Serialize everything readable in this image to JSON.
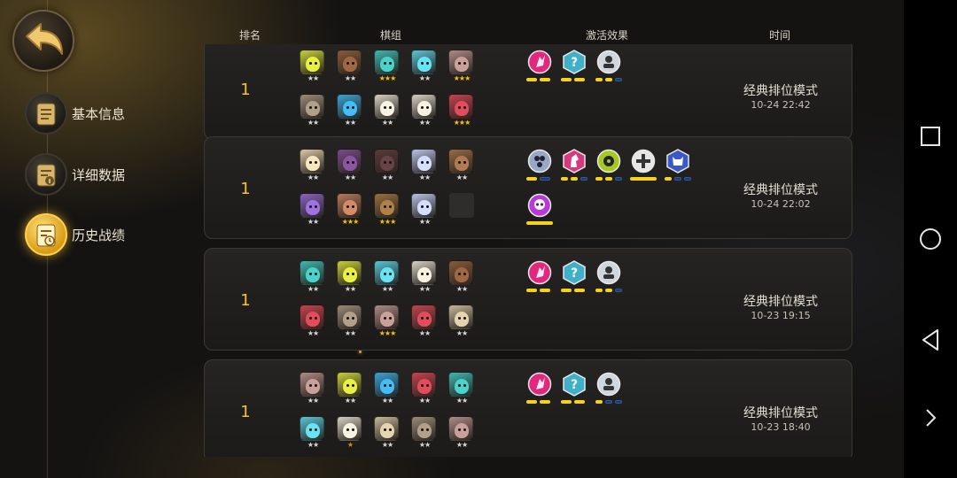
{
  "nav": {
    "items": [
      {
        "label": "基本信息",
        "icon": "document-icon",
        "active": false
      },
      {
        "label": "详细数据",
        "icon": "info-document-icon",
        "active": false
      },
      {
        "label": "历史战绩",
        "icon": "history-clock-icon",
        "active": true
      }
    ]
  },
  "table": {
    "headers": {
      "rank": "排名",
      "lineup": "棋组",
      "synergy": "激活效果",
      "time": "时间"
    },
    "rows": [
      {
        "rank": "1",
        "mode": "经典排位模式",
        "time": "10-24 22:42",
        "units": [
          {
            "name": "yellow-creature-portrait",
            "color": "#c9d13a",
            "stars": "★★",
            "star_color": "#d8d8d8"
          },
          {
            "name": "brown-warrior-portrait",
            "color": "#8a5a3a",
            "stars": "★★",
            "star_color": "#d8d8d8"
          },
          {
            "name": "teal-knight-portrait",
            "color": "#3fb8b0",
            "stars": "★★★",
            "star_color": "#f5c400"
          },
          {
            "name": "cyan-goggles-portrait",
            "color": "#59c6d6",
            "stars": "★★",
            "star_color": "#d8d8d8"
          },
          {
            "name": "pale-brute-portrait",
            "color": "#b08b86",
            "stars": "★★★",
            "star_color": "#f5c400"
          },
          {
            "name": "horned-beast-portrait",
            "color": "#9c8b78",
            "stars": "★★",
            "star_color": "#d8d8d8"
          },
          {
            "name": "blue-gem-portrait",
            "color": "#3aa4d8",
            "stars": "★★",
            "star_color": "#d8d8d8"
          },
          {
            "name": "white-sage-portrait",
            "color": "#d8d2c4",
            "stars": "★★",
            "star_color": "#d8d8d8"
          },
          {
            "name": "white-sage-portrait",
            "color": "#d8d2c4",
            "stars": "★★",
            "star_color": "#d8d8d8"
          },
          {
            "name": "red-demon-portrait",
            "color": "#c5434f",
            "stars": "★★★",
            "star_color": "#f5c400"
          }
        ],
        "synergies": [
          {
            "icon": "pink-fist-icon",
            "color": "#e0287e",
            "bars": 2,
            "filled": 2
          },
          {
            "icon": "mystery-hex-icon",
            "color": "#3fb0c8",
            "bars": 2,
            "filled": 2
          },
          {
            "icon": "robot-icon",
            "color": "#cfd6de",
            "bars": 3,
            "filled": 2
          }
        ]
      },
      {
        "rank": "1",
        "mode": "经典排位模式",
        "time": "10-24 22:02",
        "units": [
          {
            "name": "bald-monk-portrait",
            "color": "#d8c8a6",
            "stars": "★★",
            "star_color": "#d8d8d8"
          },
          {
            "name": "purple-viking-portrait",
            "color": "#7a4a8a",
            "stars": "★★",
            "star_color": "#d8d8d8"
          },
          {
            "name": "dark-elf-portrait",
            "color": "#5a3a3a",
            "stars": "★★",
            "star_color": "#d8d8d8"
          },
          {
            "name": "ghost-spirit-portrait",
            "color": "#b8c2e6",
            "stars": "★★",
            "star_color": "#d8d8d8"
          },
          {
            "name": "bearded-hero-portrait",
            "color": "#9a6a48",
            "stars": "★★",
            "star_color": "#d8d8d8"
          },
          {
            "name": "violet-bat-portrait",
            "color": "#8a62c4",
            "stars": "★★",
            "star_color": "#d8d8d8"
          },
          {
            "name": "red-captain-portrait",
            "color": "#b87a5a",
            "stars": "★★★",
            "star_color": "#f5c400"
          },
          {
            "name": "wood-tree-portrait",
            "color": "#9a7040",
            "stars": "★★★",
            "star_color": "#f5c400"
          },
          {
            "name": "ghost-spirit-portrait",
            "color": "#b8c2e6",
            "stars": "★★",
            "star_color": "#d8d8d8"
          },
          {
            "name": "empty-slot",
            "color": "",
            "stars": "",
            "star_color": ""
          }
        ],
        "synergies": [
          {
            "icon": "paw-swirl-icon",
            "color": "#9aa8c8",
            "bars": 2,
            "filled": 1
          },
          {
            "icon": "pink-knight-icon",
            "color": "#d8387e",
            "bars": 3,
            "filled": 2
          },
          {
            "icon": "green-shield-icon",
            "color": "#a8c820",
            "bars": 3,
            "filled": 2
          },
          {
            "icon": "white-cross-icon",
            "color": "#e6e6e6",
            "bars": 1,
            "filled": 1
          },
          {
            "icon": "blue-demon-icon",
            "color": "#3a58c8",
            "bars": 3,
            "filled": 1
          },
          {
            "icon": "purple-skull-icon",
            "color": "#b83ad8",
            "bars": 1,
            "filled": 1
          }
        ]
      },
      {
        "rank": "1",
        "mode": "经典排位模式",
        "time": "10-23 19:15",
        "units": [
          {
            "name": "teal-knight-portrait",
            "color": "#3fb8b0",
            "stars": "★★",
            "star_color": "#d8d8d8"
          },
          {
            "name": "yellow-creature-portrait",
            "color": "#c9d13a",
            "stars": "★★",
            "star_color": "#d8d8d8"
          },
          {
            "name": "cyan-goggles-portrait",
            "color": "#59c6d6",
            "stars": "★★",
            "star_color": "#d8d8d8"
          },
          {
            "name": "white-sage-portrait",
            "color": "#d8d2c4",
            "stars": "★★",
            "star_color": "#d8d8d8"
          },
          {
            "name": "brown-warrior-portrait",
            "color": "#8a5a3a",
            "stars": "★★",
            "star_color": "#d8d8d8"
          },
          {
            "name": "red-demon-portrait",
            "color": "#c5434f",
            "stars": "★★",
            "star_color": "#d8d8d8"
          },
          {
            "name": "horned-beast-portrait",
            "color": "#9c8b78",
            "stars": "★★",
            "star_color": "#d8d8d8"
          },
          {
            "name": "pale-brute-portrait",
            "color": "#b08b86",
            "stars": "★★★",
            "star_color": "#f5c400"
          },
          {
            "name": "red-demon-portrait",
            "color": "#c5434f",
            "stars": "★★",
            "star_color": "#d8d8d8"
          },
          {
            "name": "goggle-gnome-portrait",
            "color": "#c8b89a",
            "stars": "★★",
            "star_color": "#d8d8d8"
          }
        ],
        "synergies": [
          {
            "icon": "pink-fist-icon",
            "color": "#e0287e",
            "bars": 2,
            "filled": 2
          },
          {
            "icon": "mystery-hex-icon",
            "color": "#3fb0c8",
            "bars": 2,
            "filled": 2
          },
          {
            "icon": "robot-icon",
            "color": "#cfd6de",
            "bars": 3,
            "filled": 2
          }
        ]
      },
      {
        "rank": "1",
        "mode": "经典排位模式",
        "time": "10-23 18:40",
        "units": [
          {
            "name": "pale-brute-portrait",
            "color": "#b08b86",
            "stars": "★★",
            "star_color": "#d8d8d8"
          },
          {
            "name": "yellow-creature-portrait",
            "color": "#c9d13a",
            "stars": "★★",
            "star_color": "#d8d8d8"
          },
          {
            "name": "blue-gem-portrait",
            "color": "#3aa4d8",
            "stars": "★★",
            "star_color": "#d8d8d8"
          },
          {
            "name": "red-demon-portrait",
            "color": "#c5434f",
            "stars": "★★",
            "star_color": "#d8d8d8"
          },
          {
            "name": "teal-knight-portrait",
            "color": "#3fb8b0",
            "stars": "★★",
            "star_color": "#d8d8d8"
          },
          {
            "name": "cyan-goggles-portrait",
            "color": "#59c6d6",
            "stars": "★★",
            "star_color": "#d8d8d8"
          },
          {
            "name": "white-sage-portrait",
            "color": "#d8d2c4",
            "stars": "★",
            "star_color": "#d88a20"
          },
          {
            "name": "goggle-gnome-portrait",
            "color": "#c8b89a",
            "stars": "★★",
            "star_color": "#d8d8d8"
          },
          {
            "name": "horned-beast-portrait",
            "color": "#9c8b78",
            "stars": "★★",
            "star_color": "#d8d8d8"
          },
          {
            "name": "pale-brute-portrait",
            "color": "#b08b86",
            "stars": "★★",
            "star_color": "#d8d8d8"
          }
        ],
        "synergies": [
          {
            "icon": "pink-fist-icon",
            "color": "#e0287e",
            "bars": 2,
            "filled": 2
          },
          {
            "icon": "mystery-hex-icon",
            "color": "#3fb0c8",
            "bars": 2,
            "filled": 2
          },
          {
            "icon": "robot-icon",
            "color": "#cfd6de",
            "bars": 3,
            "filled": 1
          }
        ]
      }
    ]
  },
  "colors": {
    "accent": "#f2c33a",
    "bar_on": "#f5d21c",
    "bar_off": "#1e3a6a"
  },
  "system_nav": [
    {
      "icon": "square-recents-icon"
    },
    {
      "icon": "circle-home-icon"
    },
    {
      "icon": "triangle-back-icon"
    },
    {
      "icon": "chevron-right-icon"
    }
  ]
}
